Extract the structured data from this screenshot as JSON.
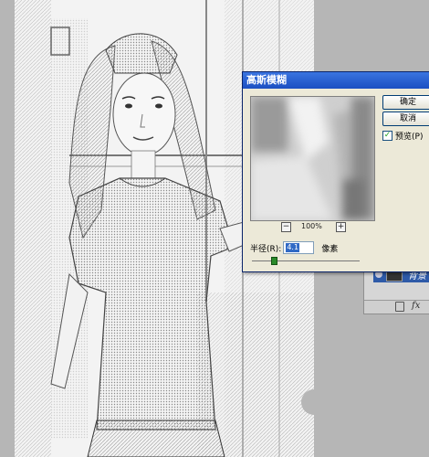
{
  "dialog": {
    "title": "高斯模糊",
    "ok_label": "确定",
    "cancel_label": "取消",
    "preview_label": "预览(P)",
    "preview_checked": true,
    "zoom_minus": "−",
    "zoom_plus": "+",
    "zoom_level": "100%",
    "radius_label": "半径(R):",
    "radius_value": "4.1",
    "radius_unit": "像素",
    "slider_fraction": 0.2
  },
  "layers_panel": {
    "layer_name": "背景",
    "fx_label": "fx"
  }
}
